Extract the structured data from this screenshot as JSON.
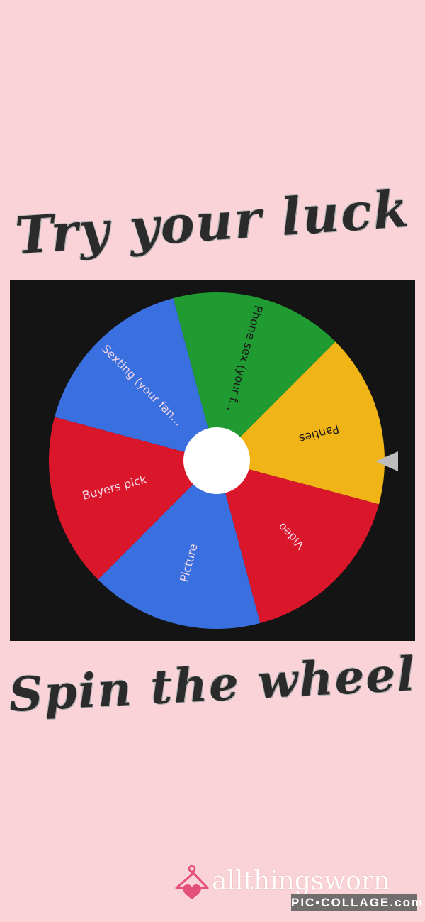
{
  "headline_top": "Try your luck",
  "headline_bottom": "Spin the wheel",
  "wheel": {
    "segments": [
      {
        "label": "Sexting (your fan...",
        "color": "#3a6fe0"
      },
      {
        "label": "Phone sex (your f...",
        "color": "#1f9b31"
      },
      {
        "label": "Panties",
        "color": "#f0b416"
      },
      {
        "label": "Video",
        "color": "#d9162a"
      },
      {
        "label": "Picture",
        "color": "#3a6fe0"
      },
      {
        "label": "Buyers pick",
        "color": "#d9162a"
      }
    ]
  },
  "footer": {
    "brand_name": "allthingsworn",
    "badge_text": "PIC•COLLAGE",
    "badge_suffix": ".com"
  }
}
